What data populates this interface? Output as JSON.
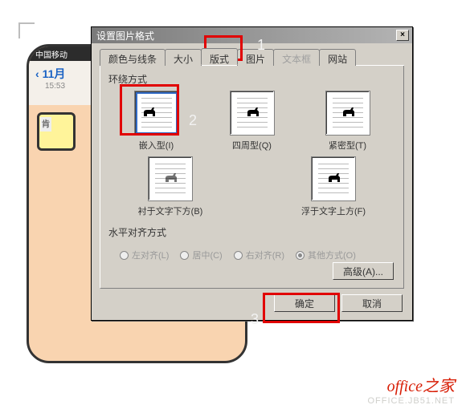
{
  "phone": {
    "status": "中国移动",
    "back": "11月",
    "time": "15:53",
    "item_label": "肯"
  },
  "dialog": {
    "title": "设置图片格式",
    "close": "×",
    "tabs": [
      {
        "label": "颜色与线条"
      },
      {
        "label": "大小"
      },
      {
        "label": "版式",
        "active": true
      },
      {
        "label": "图片"
      },
      {
        "label": "文本框",
        "disabled": true
      },
      {
        "label": "网站"
      }
    ],
    "group_wrap_label": "环绕方式",
    "wrap_options": [
      {
        "label": "嵌入型(I)",
        "selected": true
      },
      {
        "label": "四周型(Q)"
      },
      {
        "label": "紧密型(T)"
      },
      {
        "label": "衬于文字下方(B)"
      },
      {
        "label": "浮于文字上方(F)"
      }
    ],
    "group_halign_label": "水平对齐方式",
    "halign_options": [
      {
        "label": "左对齐(L)"
      },
      {
        "label": "居中(C)"
      },
      {
        "label": "右对齐(R)"
      },
      {
        "label": "其他方式(O)",
        "checked": true
      }
    ],
    "advanced_button": "高级(A)...",
    "ok_button": "确定",
    "cancel_button": "取消"
  },
  "annotations": {
    "num1": "1",
    "num2": "2",
    "num3": "3"
  },
  "watermark": {
    "line1": "office之家",
    "line2": "OFFICE.JB51.NET"
  }
}
